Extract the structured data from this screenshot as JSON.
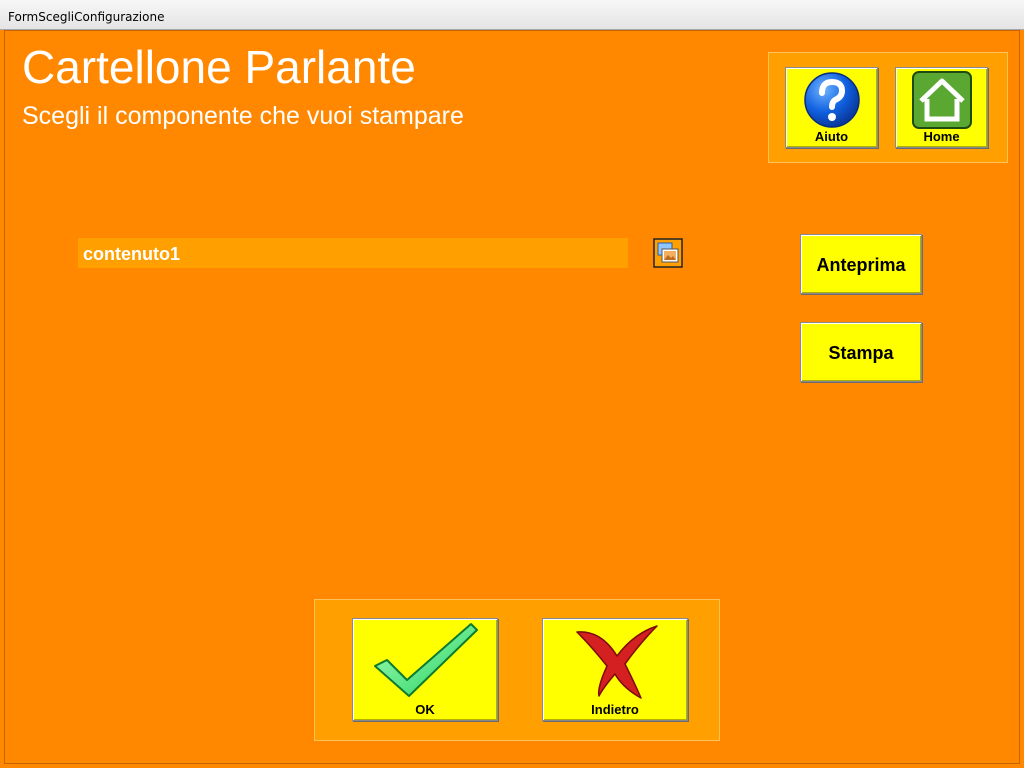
{
  "window": {
    "title": "FormScegliConfigurazione"
  },
  "header": {
    "app_title": "Cartellone Parlante",
    "subtitle": "Scegli il componente che vuoi stampare"
  },
  "nav": {
    "help_label": "Aiuto",
    "home_label": "Home"
  },
  "content": {
    "items": [
      {
        "label": "contenuto1",
        "icon": "picture-icon"
      }
    ]
  },
  "actions": {
    "preview_label": "Anteprima",
    "print_label": "Stampa"
  },
  "footer": {
    "ok_label": "OK",
    "back_label": "Indietro"
  },
  "colors": {
    "background": "#ff8800",
    "panel": "#ffa000",
    "button": "#ffff00",
    "text": "#ffffff"
  }
}
